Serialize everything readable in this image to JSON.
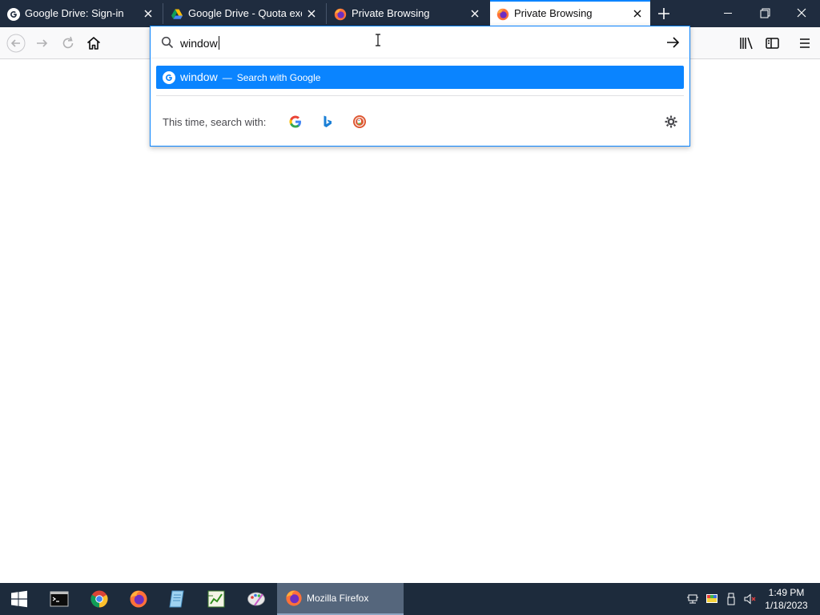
{
  "tabs": [
    {
      "title": "Google Drive: Sign-in",
      "favicon": "google-icon",
      "active": false
    },
    {
      "title": "Google Drive - Quota exce",
      "favicon": "google-drive-icon",
      "active": false
    },
    {
      "title": "Private Browsing",
      "favicon": "firefox-icon",
      "active": false
    },
    {
      "title": "Private Browsing",
      "favicon": "firefox-icon",
      "active": true
    }
  ],
  "urlbar": {
    "value": "window",
    "suggestion": {
      "term": "window",
      "separator": "—",
      "action": "Search with Google"
    },
    "oneoff_label": "This time, search with:",
    "engines": [
      "google-icon",
      "bing-icon",
      "duckduckgo-icon"
    ]
  },
  "taskbar": {
    "active_task_label": "Mozilla Firefox",
    "time": "1:49 PM",
    "date": "1/18/2023"
  },
  "colors": {
    "accent": "#0a84ff",
    "tabbar_bg": "#1f2c3f",
    "taskbar_bg": "#1d2b3c"
  }
}
